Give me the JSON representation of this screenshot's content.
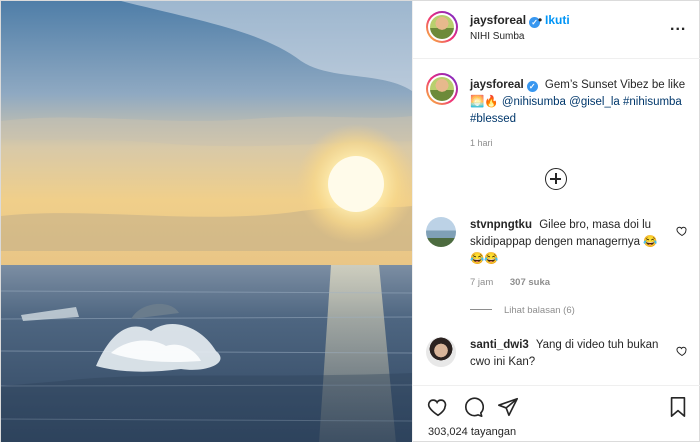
{
  "post": {
    "author": {
      "username": "jaysforeal",
      "verified_icon": "verified-badge-icon",
      "follow_separator": "•",
      "follow_label": "Ikuti",
      "location": "NIHI Sumba"
    },
    "more_label": "...",
    "caption": {
      "username": "jaysforeal",
      "text": "Gem’s Sunset Vibez be like 🌅🔥",
      "mentions": [
        "@nihisumba",
        "@gisel_la"
      ],
      "hashtags": [
        "#nihisumba",
        "#blessed"
      ],
      "time": "1 hari"
    },
    "comments": [
      {
        "username": "stvnpngtku",
        "text": "Gilee bro, masa doi lu skidipappap dengen managernya 😂😂😂",
        "time": "7 jam",
        "likes": "307 suka",
        "replies_label": "Lihat balasan (6)"
      },
      {
        "username": "santi_dwi3",
        "text": "Yang di video tuh bukan cwo ini Kan?"
      }
    ],
    "views": "303,024 tayangan",
    "colors": {
      "accent": "#0095f6",
      "verified": "#3897f0",
      "text": "#262626",
      "muted": "#8e8e8e",
      "link": "#00376b"
    },
    "icons": {
      "like": "heart-icon",
      "comment": "comment-icon",
      "share": "share-icon",
      "save": "bookmark-icon",
      "add_comment": "plus-circle-icon"
    }
  }
}
